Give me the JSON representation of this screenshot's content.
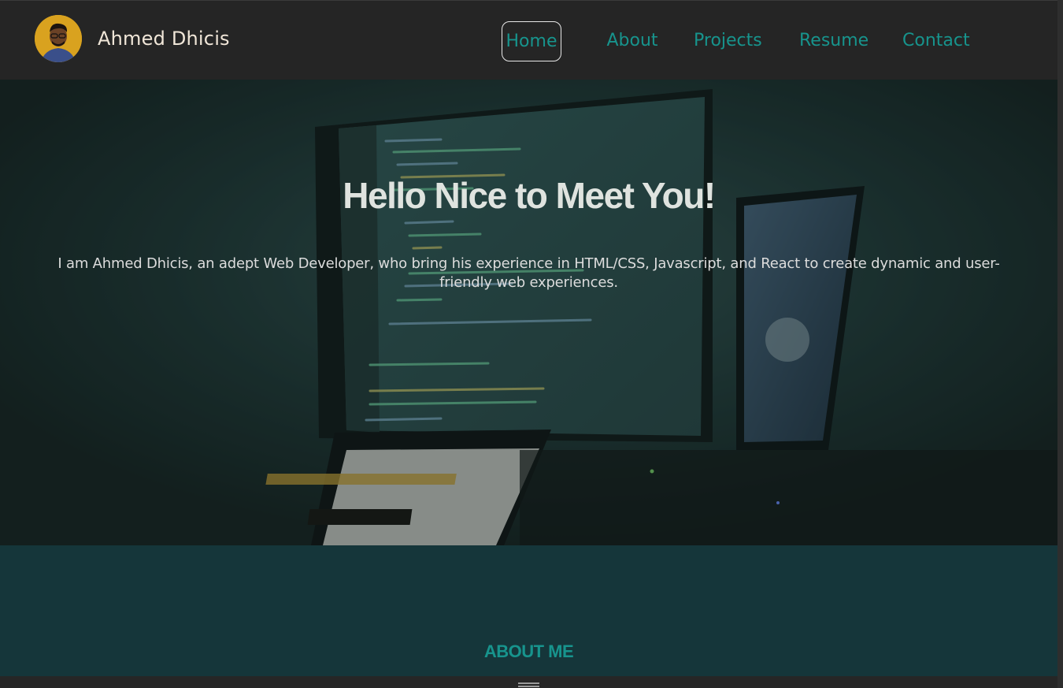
{
  "header": {
    "brand_name": "Ahmed Dhicis",
    "nav": [
      {
        "label": "Home",
        "active": true
      },
      {
        "label": "About",
        "active": false
      },
      {
        "label": "Projects",
        "active": false
      },
      {
        "label": "Resume",
        "active": false
      },
      {
        "label": "Contact",
        "active": false
      }
    ]
  },
  "hero": {
    "title": "Hello Nice to Meet You!",
    "intro": "I am Ahmed Dhicis, an adept Web Developer, who bring his experience in HTML/CSS, Javascript, and React to create dynamic and user-friendly web experiences."
  },
  "about": {
    "title": "ABOUT ME"
  },
  "colors": {
    "accent": "#17948d",
    "header_bg": "#252525",
    "about_bg": "#15363a",
    "avatar_bg": "#d9a21f"
  },
  "icons": {
    "avatar": "profile-photo",
    "bottom": "menu-icon"
  }
}
